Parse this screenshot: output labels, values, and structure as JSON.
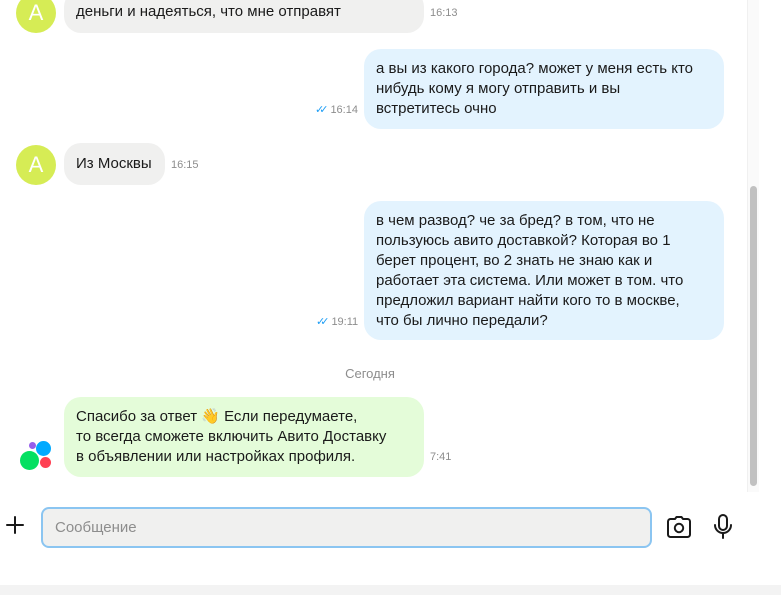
{
  "messages": [
    {
      "id": "m1",
      "direction": "in",
      "avatar": "А",
      "text": "деньги и надеяться, что мне отправят",
      "time": "16:13"
    },
    {
      "id": "m2",
      "direction": "out",
      "text": "а вы из какого города? может у меня есть кто\nнибудь кому я могу отправить и вы\nвстретитесь очно",
      "time": "16:14",
      "read_ticks": "✓✓"
    },
    {
      "id": "m3",
      "direction": "in",
      "avatar": "А",
      "text": "Из Москвы",
      "time": "16:15"
    },
    {
      "id": "m4",
      "direction": "out",
      "text": "в чем развод? че за бред? в том, что не\nпользуюсь авито доставкой? Которая во 1\nберет процент, во 2 знать не знаю как и\nработает эта система. Или может в том. что\nпредложил вариант найти кого то в москве,\nчто бы лично передали?",
      "time": "19:11",
      "read_ticks": "✓✓"
    },
    {
      "id": "m5",
      "direction": "system",
      "text": "Спасибо за ответ 👋 Если передумаете,\nто всегда сможете включить Авито Доставку\nв объявлении или настройках профиля.",
      "time": "7:41"
    }
  ],
  "date_separator": "Сегодня",
  "composer": {
    "placeholder": "Сообщение",
    "value": ""
  },
  "colors": {
    "avatar": "#d6ec55",
    "incoming_bubble": "#f0f0ef",
    "outgoing_bubble": "#e3f3fe",
    "system_bubble": "#e4fcd9",
    "read_ticks": "#1e9ef5",
    "input_border": "#8bc5f1"
  },
  "icons": {
    "attach": "plus-icon",
    "camera": "camera-icon",
    "microphone": "microphone-icon",
    "logo": "avito-logo-icon"
  }
}
